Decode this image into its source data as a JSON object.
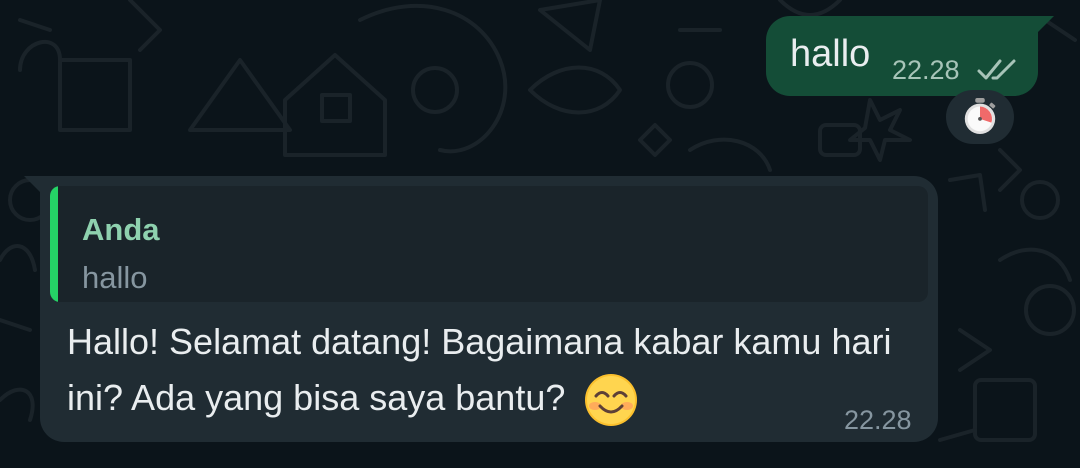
{
  "outgoing_message": {
    "text": "hallo",
    "time": "22.28",
    "status_icon": "double-check-icon",
    "disappearing_icon": "stopwatch-icon"
  },
  "incoming_message": {
    "reply_quote": {
      "author": "Anda",
      "text": "hallo"
    },
    "text": "Hallo! Selamat datang! Bagaimana kabar kamu hari ini? Ada yang bisa saya bantu?",
    "emoji_icon": "smiling-face-emoji-icon",
    "time": "22.28"
  },
  "colors": {
    "background": "#0b141a",
    "outgoing_bubble": "#144d37",
    "incoming_bubble": "#202c33",
    "quote_accent": "#25d366",
    "quote_author": "#8ed1ae"
  }
}
